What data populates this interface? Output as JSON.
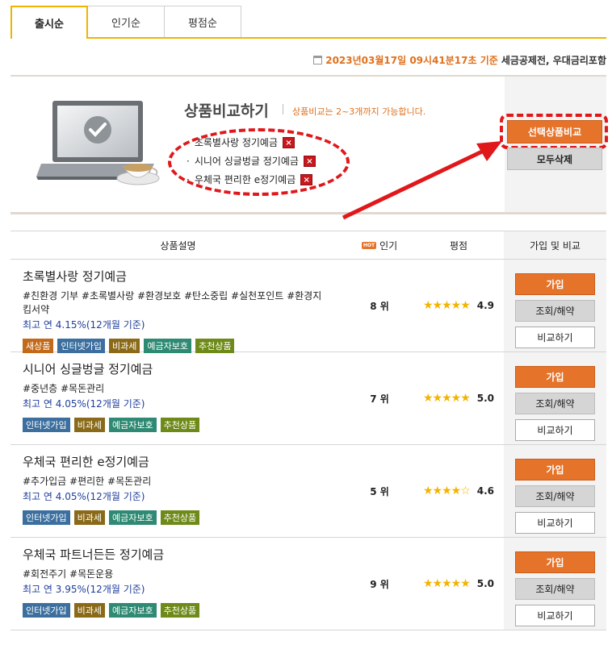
{
  "tabs": [
    {
      "label": "출시순",
      "active": true
    },
    {
      "label": "인기순",
      "active": false
    },
    {
      "label": "평점순",
      "active": false
    }
  ],
  "dateline": {
    "date": "2023년03월17일 09시41분17초 기준",
    "note": "세금공제전, 우대금리포함"
  },
  "compare": {
    "title": "상품비교하기",
    "note": "상품비교는 2~3개까지 가능합니다.",
    "items": [
      "초록별사랑 정기예금",
      "시니어 싱글벙글 정기예금",
      "우체국 편리한 e정기예금"
    ],
    "remove_label": "×",
    "compare_button": "선택상품비교",
    "clear_button": "모두삭제"
  },
  "table": {
    "headers": {
      "desc": "상품설명",
      "hot": "HOT",
      "popularity": "인기",
      "rating": "평점",
      "action": "가입 및 비교"
    },
    "rows": [
      {
        "name": "초록별사랑 정기예금",
        "tags": "#친환경 기부 #초록별사랑 #환경보호 #탄소중립 #실천포인트 #환경지킴서약",
        "rate": "최고 연 4.15%(12개월 기준)",
        "badges": [
          "새상품",
          "인터넷가입",
          "비과세",
          "예금자보호",
          "추천상품"
        ],
        "rank": "8 위",
        "stars": "★★★★★",
        "score": "4.9"
      },
      {
        "name": "시니어 싱글벙글 정기예금",
        "tags": "#중년층 #목돈관리",
        "rate": "최고 연 4.05%(12개월 기준)",
        "badges": [
          "인터넷가입",
          "비과세",
          "예금자보호",
          "추천상품"
        ],
        "rank": "7 위",
        "stars": "★★★★★",
        "score": "5.0"
      },
      {
        "name": "우체국 편리한 e정기예금",
        "tags": "#추가입금 #편리한 #목돈관리",
        "rate": "최고 연 4.05%(12개월 기준)",
        "badges": [
          "인터넷가입",
          "비과세",
          "예금자보호",
          "추천상품"
        ],
        "rank": "5 위",
        "stars": "★★★★☆",
        "score": "4.6"
      },
      {
        "name": "우체국 파트너든든 정기예금",
        "tags": "#회전주기 #목돈운용",
        "rate": "최고 연 3.95%(12개월 기준)",
        "badges": [
          "인터넷가입",
          "비과세",
          "예금자보호",
          "추천상품"
        ],
        "rank": "9 위",
        "stars": "★★★★★",
        "score": "5.0"
      }
    ],
    "buttons": {
      "join": "가입",
      "view": "조회/해약",
      "compare": "비교하기"
    }
  }
}
